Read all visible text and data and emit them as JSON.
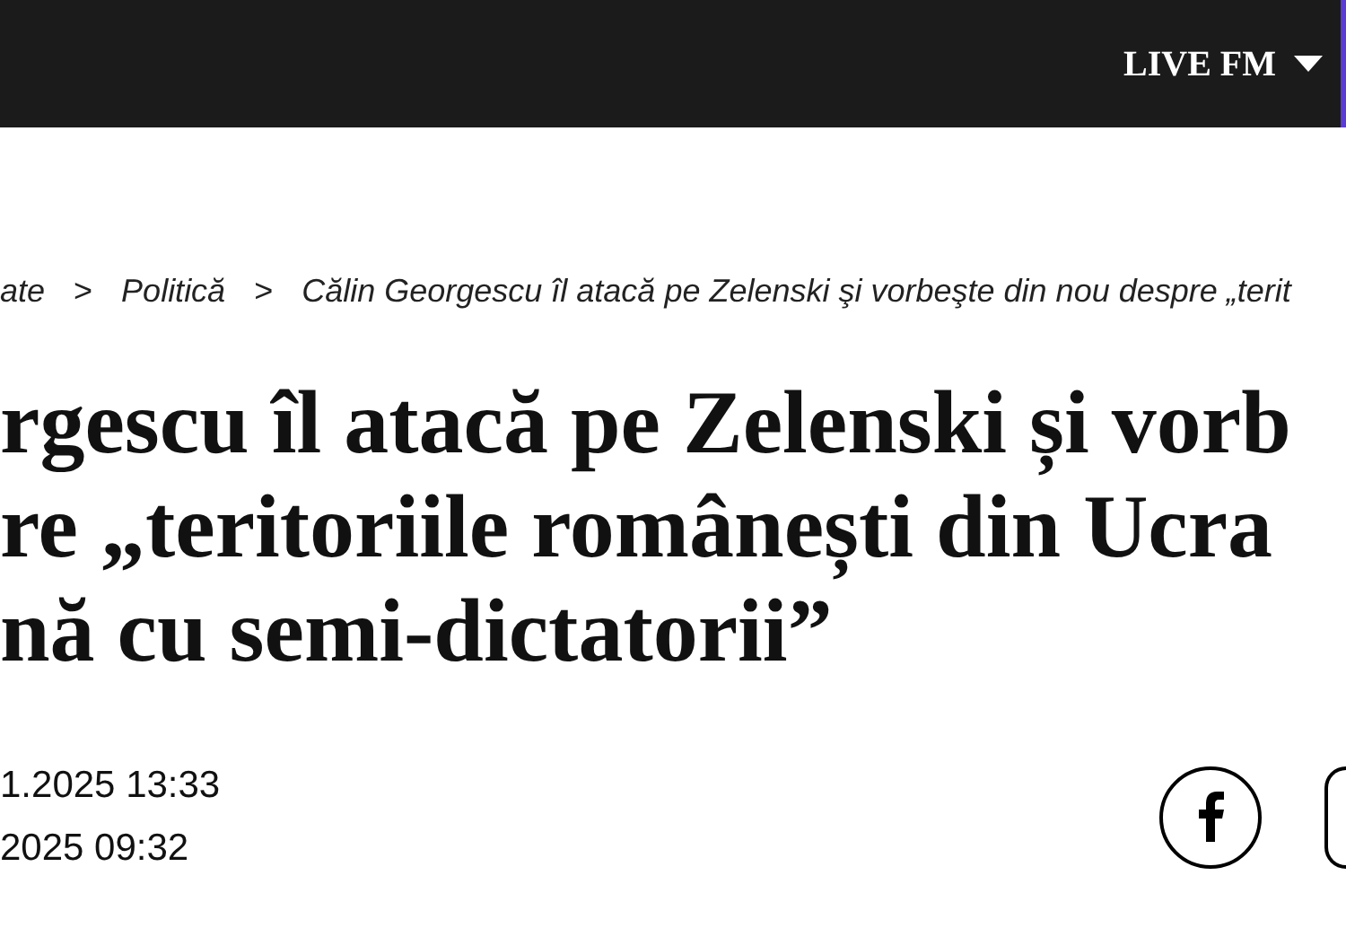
{
  "header": {
    "menu": {
      "label": "LIVE FM",
      "expanded": false
    }
  },
  "breadcrumb": [
    "ate",
    "Politică",
    "Călin Georgescu îl atacă pe Zelenski şi vorbeşte din nou despre „terit"
  ],
  "breadcrumb_separator": ">",
  "article": {
    "title_lines": [
      "rgescu îl atacă pe Zelenski și vorb",
      "re „teritoriile românești din Ucra",
      "nă cu semi-dictatorii”"
    ],
    "dates": [
      "1.2025 13:33",
      "2025 09:32"
    ],
    "share": [
      {
        "kind": "facebook"
      },
      {
        "kind": "other"
      }
    ]
  }
}
